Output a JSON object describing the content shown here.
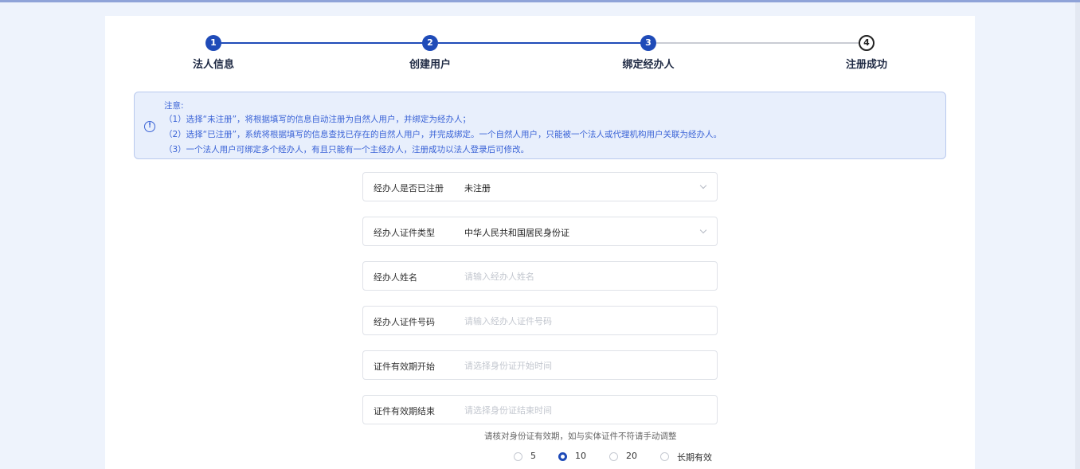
{
  "stepper": {
    "steps": [
      {
        "number": "1",
        "label": "法人信息",
        "status": "done"
      },
      {
        "number": "2",
        "label": "创建用户",
        "status": "done"
      },
      {
        "number": "3",
        "label": "绑定经办人",
        "status": "done"
      },
      {
        "number": "4",
        "label": "注册成功",
        "status": "todo"
      }
    ]
  },
  "notice": {
    "icon": "info-icon",
    "title": "注意:",
    "lines": [
      "（1）选择“未注册”，将根据填写的信息自动注册为自然人用户，并绑定为经办人；",
      "（2）选择“已注册”，系统将根据填写的信息查找已存在的自然人用户，并完成绑定。一个自然人用户，只能被一个法人或代理机构用户关联为经办人。",
      "（3）一个法人用户可绑定多个经办人，有且只能有一个主经办人，注册成功以法人登录后可修改。"
    ]
  },
  "form": {
    "registered": {
      "label": "经办人是否已注册",
      "value": "未注册"
    },
    "id_type": {
      "label": "经办人证件类型",
      "value": "中华人民共和国居民身份证"
    },
    "name": {
      "label": "经办人姓名",
      "placeholder": "请输入经办人姓名"
    },
    "id_number": {
      "label": "经办人证件号码",
      "placeholder": "请输入经办人证件号码"
    },
    "valid_start": {
      "label": "证件有效期开始",
      "placeholder": "请选择身份证开始时间"
    },
    "valid_end": {
      "label": "证件有效期结束",
      "placeholder": "请选择身份证结束时间"
    },
    "hint": "请核对身份证有效期，如与实体证件不符请手动调整",
    "validity_options": [
      {
        "label": "5",
        "checked": false
      },
      {
        "label": "10",
        "checked": true
      },
      {
        "label": "20",
        "checked": false
      },
      {
        "label": "长期有效",
        "checked": false
      }
    ]
  },
  "colors": {
    "primary": "#1f4bb8",
    "notice_bg": "#e8effc",
    "notice_text": "#3a63d6",
    "page_bg": "#eef3fc"
  }
}
